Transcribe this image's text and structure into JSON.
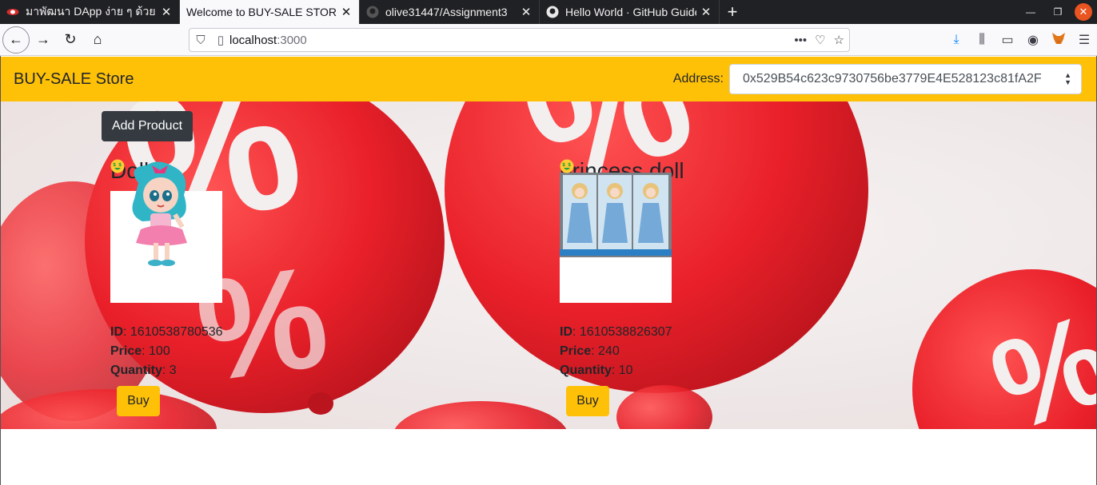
{
  "browser": {
    "tabs": [
      {
        "title": "มาพัฒนา DApp ง่าย ๆ ด้วย",
        "active": false,
        "icon": "red-lens-icon"
      },
      {
        "title": "Welcome to BUY-SALE STORE",
        "active": true,
        "icon": ""
      },
      {
        "title": "olive31447/Assignment3",
        "active": false,
        "icon": "github-icon"
      },
      {
        "title": "Hello World · GitHub Guides",
        "active": false,
        "icon": "github-icon"
      }
    ],
    "url_host": "localhost",
    "url_port": ":3000"
  },
  "app": {
    "brand": "BUY-SALE Store",
    "address_label": "Address:",
    "address_value": "0x529B54c623c9730756be3779E4E528123c81fA2F",
    "add_product_label": "Add Product",
    "colors": {
      "navbar": "#ffc107",
      "dark_button": "#343a40",
      "buy_button": "#ffc107"
    }
  },
  "products": [
    {
      "name": "Doll",
      "id_label": "ID",
      "id": ": 1610538780536",
      "price_label": "Price",
      "price": " 100",
      "quantity_label": "Quantity",
      "quantity": ": 3",
      "buy_label": "Buy"
    },
    {
      "name": "princess doll",
      "id_label": "ID",
      "id": ": 1610538826307",
      "price_label": "Price",
      "price": " 240",
      "quantity_label": "Quantity",
      "quantity": ": 10",
      "buy_label": "Buy"
    }
  ]
}
